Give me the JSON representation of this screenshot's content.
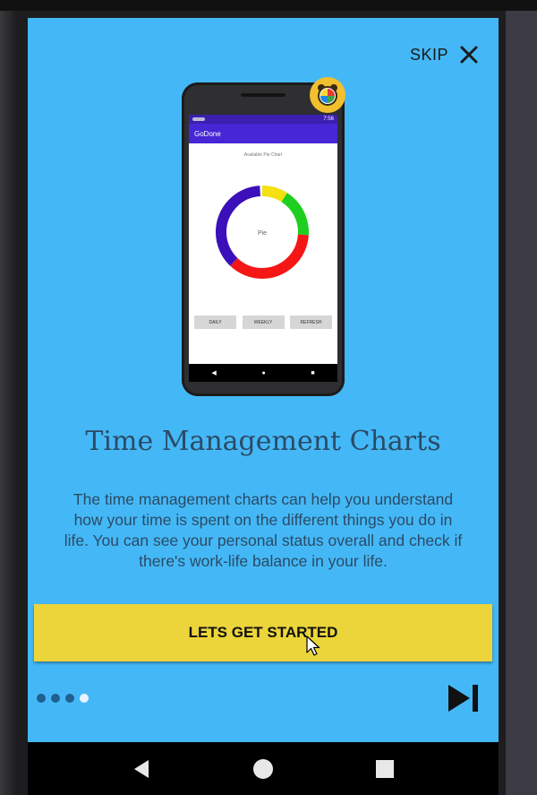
{
  "header": {
    "skip_label": "SKIP"
  },
  "illustration": {
    "app_title": "GoDone",
    "status_time": "7:56",
    "chart_caption": "Available Pie Chart",
    "pie_center_label": "Pie",
    "buttons": [
      "DAILY",
      "WEEKLY",
      "REFRESH"
    ],
    "ring_colors": [
      "#f4e10f",
      "#1fcf20",
      "#f51616",
      "#3b0fba"
    ]
  },
  "content": {
    "title": "Time Management Charts",
    "description": "The time management charts can help you understand how your time is spent on the different things you do in life. You can see your personal status overall and check if there's work-life balance in your life."
  },
  "cta": {
    "label": "LETS GET STARTED"
  },
  "pager": {
    "total": 4,
    "active_index": 3
  },
  "icons": {
    "close": "close-icon",
    "skip_to_end": "skip-to-end-icon",
    "back": "back-icon",
    "home": "home-icon",
    "recents": "recents-icon",
    "alarm": "alarm-clock-icon",
    "cursor": "mouse-cursor-icon"
  }
}
